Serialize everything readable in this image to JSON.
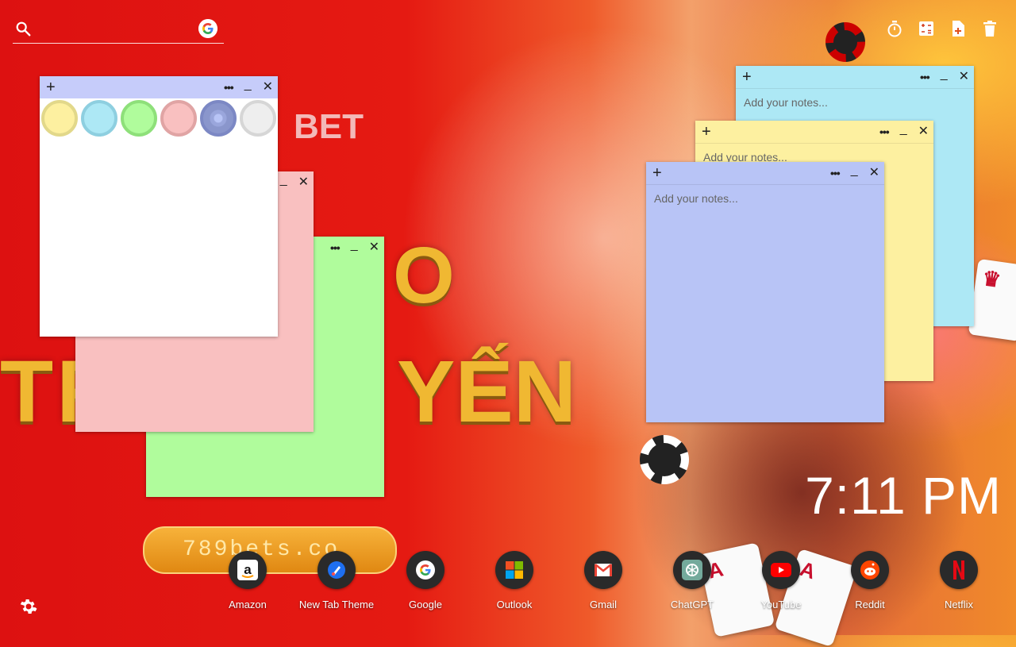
{
  "background": {
    "brand_fragment": "BET",
    "letter_o": "O",
    "row_fragment": "TR",
    "word_fragment": "YẾN",
    "pill_text": "789bets.co"
  },
  "search": {
    "placeholder": "",
    "value": "",
    "search_icon": "search-icon",
    "provider_icon": "google-icon"
  },
  "toolbar": {
    "icons": [
      "timer-icon",
      "calculator-icon",
      "add-note-icon",
      "trash-icon"
    ]
  },
  "notes": {
    "plus": "+",
    "more": "•••",
    "minimize": "_",
    "close": "✕",
    "placeholder": "Add your notes...",
    "blue_color": "#ade8f5",
    "yellow_color": "#fdf0a0",
    "lavender_color": "#b8c4f6",
    "green_color": "#b0fc9c",
    "pink_color": "#f9c0c0",
    "white_color": "#ffffff"
  },
  "swatches": [
    {
      "name": "yellow",
      "fill": "#fdf0a0",
      "ring": "#e2d88a"
    },
    {
      "name": "blue",
      "fill": "#ade8f5",
      "ring": "#8ecfe0"
    },
    {
      "name": "green",
      "fill": "#b0fc9c",
      "ring": "#8ee07a"
    },
    {
      "name": "pink",
      "fill": "#f9c0c0",
      "ring": "#e0a4a4"
    },
    {
      "name": "lavender",
      "fill": "#9aa6dc",
      "ring": "#7c88c4",
      "selected": true
    },
    {
      "name": "white",
      "fill": "#eeeeee",
      "ring": "#d6d6d6"
    }
  ],
  "clock": {
    "time": "7:11 PM"
  },
  "shortcuts": [
    {
      "label": "Amazon",
      "icon": "amazon-icon"
    },
    {
      "label": "New Tab Theme",
      "icon": "new-tab-theme-icon"
    },
    {
      "label": "Google",
      "icon": "google-icon"
    },
    {
      "label": "Outlook",
      "icon": "outlook-icon"
    },
    {
      "label": "Gmail",
      "icon": "gmail-icon"
    },
    {
      "label": "ChatGPT",
      "icon": "chatgpt-icon"
    },
    {
      "label": "YouTube",
      "icon": "youtube-icon"
    },
    {
      "label": "Reddit",
      "icon": "reddit-icon"
    },
    {
      "label": "Netflix",
      "icon": "netflix-icon"
    }
  ],
  "settings": {
    "icon": "gear-icon"
  }
}
